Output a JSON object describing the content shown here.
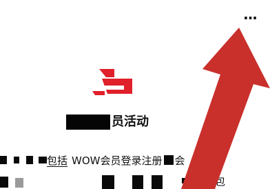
{
  "header": {
    "more_menu_label": "···",
    "more_menu_icon": "more-dots-icon"
  },
  "logo": {
    "icon": "brand-logo-icon",
    "color": "#e0202a"
  },
  "heading": {
    "visible_text": "员活动"
  },
  "body": {
    "line1_fragment": "包括",
    "line1_text": "WOW会员登录注册",
    "line1_tail": "会",
    "line2_tail": "包"
  },
  "annotation": {
    "type": "arrow",
    "icon": "red-arrow-icon",
    "color": "#c9302c"
  }
}
